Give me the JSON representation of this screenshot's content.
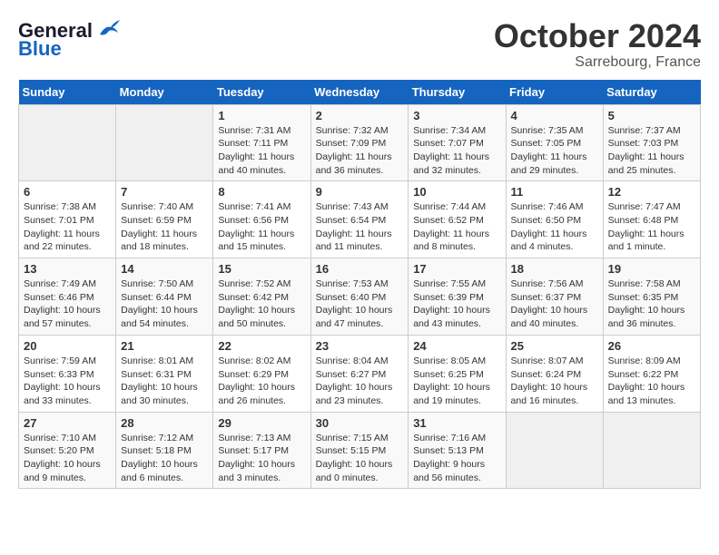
{
  "header": {
    "logo_line1": "General",
    "logo_line2": "Blue",
    "month": "October 2024",
    "location": "Sarrebourg, France"
  },
  "days_of_week": [
    "Sunday",
    "Monday",
    "Tuesday",
    "Wednesday",
    "Thursday",
    "Friday",
    "Saturday"
  ],
  "weeks": [
    [
      {
        "day": "",
        "info": ""
      },
      {
        "day": "",
        "info": ""
      },
      {
        "day": "1",
        "sunrise": "Sunrise: 7:31 AM",
        "sunset": "Sunset: 7:11 PM",
        "daylight": "Daylight: 11 hours and 40 minutes."
      },
      {
        "day": "2",
        "sunrise": "Sunrise: 7:32 AM",
        "sunset": "Sunset: 7:09 PM",
        "daylight": "Daylight: 11 hours and 36 minutes."
      },
      {
        "day": "3",
        "sunrise": "Sunrise: 7:34 AM",
        "sunset": "Sunset: 7:07 PM",
        "daylight": "Daylight: 11 hours and 32 minutes."
      },
      {
        "day": "4",
        "sunrise": "Sunrise: 7:35 AM",
        "sunset": "Sunset: 7:05 PM",
        "daylight": "Daylight: 11 hours and 29 minutes."
      },
      {
        "day": "5",
        "sunrise": "Sunrise: 7:37 AM",
        "sunset": "Sunset: 7:03 PM",
        "daylight": "Daylight: 11 hours and 25 minutes."
      }
    ],
    [
      {
        "day": "6",
        "sunrise": "Sunrise: 7:38 AM",
        "sunset": "Sunset: 7:01 PM",
        "daylight": "Daylight: 11 hours and 22 minutes."
      },
      {
        "day": "7",
        "sunrise": "Sunrise: 7:40 AM",
        "sunset": "Sunset: 6:59 PM",
        "daylight": "Daylight: 11 hours and 18 minutes."
      },
      {
        "day": "8",
        "sunrise": "Sunrise: 7:41 AM",
        "sunset": "Sunset: 6:56 PM",
        "daylight": "Daylight: 11 hours and 15 minutes."
      },
      {
        "day": "9",
        "sunrise": "Sunrise: 7:43 AM",
        "sunset": "Sunset: 6:54 PM",
        "daylight": "Daylight: 11 hours and 11 minutes."
      },
      {
        "day": "10",
        "sunrise": "Sunrise: 7:44 AM",
        "sunset": "Sunset: 6:52 PM",
        "daylight": "Daylight: 11 hours and 8 minutes."
      },
      {
        "day": "11",
        "sunrise": "Sunrise: 7:46 AM",
        "sunset": "Sunset: 6:50 PM",
        "daylight": "Daylight: 11 hours and 4 minutes."
      },
      {
        "day": "12",
        "sunrise": "Sunrise: 7:47 AM",
        "sunset": "Sunset: 6:48 PM",
        "daylight": "Daylight: 11 hours and 1 minute."
      }
    ],
    [
      {
        "day": "13",
        "sunrise": "Sunrise: 7:49 AM",
        "sunset": "Sunset: 6:46 PM",
        "daylight": "Daylight: 10 hours and 57 minutes."
      },
      {
        "day": "14",
        "sunrise": "Sunrise: 7:50 AM",
        "sunset": "Sunset: 6:44 PM",
        "daylight": "Daylight: 10 hours and 54 minutes."
      },
      {
        "day": "15",
        "sunrise": "Sunrise: 7:52 AM",
        "sunset": "Sunset: 6:42 PM",
        "daylight": "Daylight: 10 hours and 50 minutes."
      },
      {
        "day": "16",
        "sunrise": "Sunrise: 7:53 AM",
        "sunset": "Sunset: 6:40 PM",
        "daylight": "Daylight: 10 hours and 47 minutes."
      },
      {
        "day": "17",
        "sunrise": "Sunrise: 7:55 AM",
        "sunset": "Sunset: 6:39 PM",
        "daylight": "Daylight: 10 hours and 43 minutes."
      },
      {
        "day": "18",
        "sunrise": "Sunrise: 7:56 AM",
        "sunset": "Sunset: 6:37 PM",
        "daylight": "Daylight: 10 hours and 40 minutes."
      },
      {
        "day": "19",
        "sunrise": "Sunrise: 7:58 AM",
        "sunset": "Sunset: 6:35 PM",
        "daylight": "Daylight: 10 hours and 36 minutes."
      }
    ],
    [
      {
        "day": "20",
        "sunrise": "Sunrise: 7:59 AM",
        "sunset": "Sunset: 6:33 PM",
        "daylight": "Daylight: 10 hours and 33 minutes."
      },
      {
        "day": "21",
        "sunrise": "Sunrise: 8:01 AM",
        "sunset": "Sunset: 6:31 PM",
        "daylight": "Daylight: 10 hours and 30 minutes."
      },
      {
        "day": "22",
        "sunrise": "Sunrise: 8:02 AM",
        "sunset": "Sunset: 6:29 PM",
        "daylight": "Daylight: 10 hours and 26 minutes."
      },
      {
        "day": "23",
        "sunrise": "Sunrise: 8:04 AM",
        "sunset": "Sunset: 6:27 PM",
        "daylight": "Daylight: 10 hours and 23 minutes."
      },
      {
        "day": "24",
        "sunrise": "Sunrise: 8:05 AM",
        "sunset": "Sunset: 6:25 PM",
        "daylight": "Daylight: 10 hours and 19 minutes."
      },
      {
        "day": "25",
        "sunrise": "Sunrise: 8:07 AM",
        "sunset": "Sunset: 6:24 PM",
        "daylight": "Daylight: 10 hours and 16 minutes."
      },
      {
        "day": "26",
        "sunrise": "Sunrise: 8:09 AM",
        "sunset": "Sunset: 6:22 PM",
        "daylight": "Daylight: 10 hours and 13 minutes."
      }
    ],
    [
      {
        "day": "27",
        "sunrise": "Sunrise: 7:10 AM",
        "sunset": "Sunset: 5:20 PM",
        "daylight": "Daylight: 10 hours and 9 minutes."
      },
      {
        "day": "28",
        "sunrise": "Sunrise: 7:12 AM",
        "sunset": "Sunset: 5:18 PM",
        "daylight": "Daylight: 10 hours and 6 minutes."
      },
      {
        "day": "29",
        "sunrise": "Sunrise: 7:13 AM",
        "sunset": "Sunset: 5:17 PM",
        "daylight": "Daylight: 10 hours and 3 minutes."
      },
      {
        "day": "30",
        "sunrise": "Sunrise: 7:15 AM",
        "sunset": "Sunset: 5:15 PM",
        "daylight": "Daylight: 10 hours and 0 minutes."
      },
      {
        "day": "31",
        "sunrise": "Sunrise: 7:16 AM",
        "sunset": "Sunset: 5:13 PM",
        "daylight": "Daylight: 9 hours and 56 minutes."
      },
      {
        "day": "",
        "info": ""
      },
      {
        "day": "",
        "info": ""
      }
    ]
  ]
}
